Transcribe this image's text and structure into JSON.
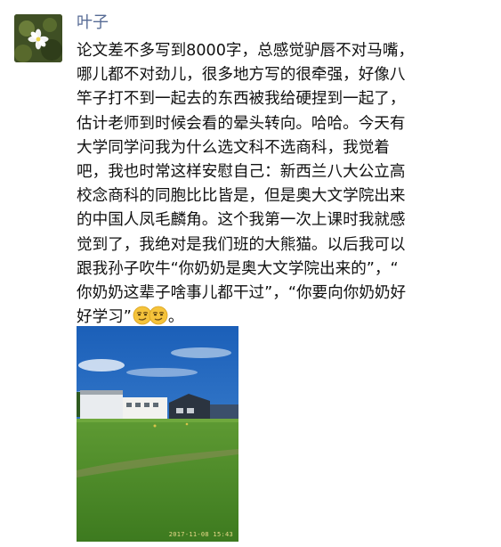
{
  "post": {
    "author": "叶子",
    "text_lines": [
      "论文差不多写到8000字，总感觉驴唇不对马嘴，",
      "哪儿都不对劲儿，很多地方写的很牵强，好像八",
      "竿子打不到一起去的东西被我给硬捏到一起了，",
      "估计老师到时候会看的晕头转向。哈哈。今天有",
      "大学同学问我为什么选文科不选商科，我觉着",
      "吧，我也时常这样安慰自己：新西兰八大公立高",
      "校念商科的同胞比比皆是，但是奥大文学院出来",
      "的中国人凤毛麟角。这个我第一次上课时我就感",
      "觉到了，我绝对是我们班的大熊猫。以后我可以",
      "跟我孙子吹牛“你奶奶是奥大文学院出来的”，“",
      "你奶奶这辈子啥事儿都干过”，“你要向你奶奶好",
      "好学习”"
    ],
    "last_line_suffix": "。",
    "emoji": [
      "smirk-emoji",
      "smirk-emoji"
    ],
    "photo": {
      "timestamp": "2017-11-08 15:43",
      "sky_color": "#2a6fc4",
      "grass_color": "#4e8a2a"
    },
    "colors": {
      "nickname": "#576b95",
      "text": "#111111"
    }
  }
}
